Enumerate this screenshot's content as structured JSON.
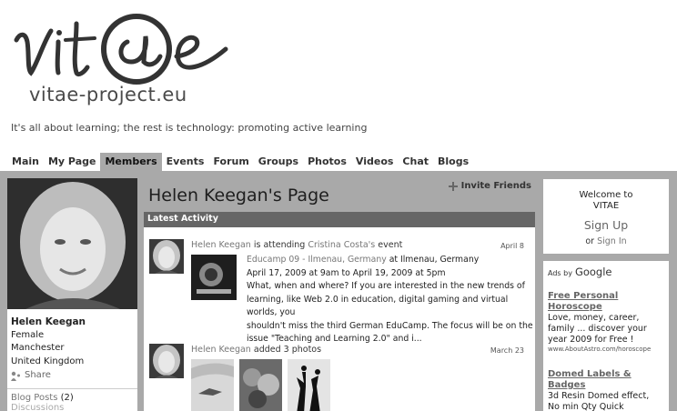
{
  "header": {
    "logo_text": "vitae-project.eu",
    "tagline": "It's all about learning; the rest is technology: promoting active learning"
  },
  "nav": {
    "items": [
      "Main",
      "My Page",
      "Members",
      "Events",
      "Forum",
      "Groups",
      "Photos",
      "Videos",
      "Chat",
      "Blogs"
    ],
    "active": "Members"
  },
  "profile": {
    "name": "Helen Keegan",
    "gender": "Female",
    "city": "Manchester",
    "country": "United Kingdom",
    "share_label": "Share",
    "blog_posts_label": "Blog Posts",
    "blog_posts_count": "(2)",
    "discussions_label": "Discussions"
  },
  "main": {
    "page_title": "Helen Keegan's Page",
    "invite_label": "Invite Friends",
    "activity_header": "Latest Activity",
    "activity": [
      {
        "user": "Helen Keegan",
        "verb": "is attending",
        "target_owner": "Cristina Costa's",
        "target_type": "event",
        "date": "April 8",
        "event_title": "Educamp 09 - Ilmenau, Germany",
        "event_location": "at Ilmenau, Germany",
        "event_time": "April 17, 2009 at 9am to April 19, 2009 at 5pm",
        "event_desc_1": "What, when and where? If you are interested in the new trends of",
        "event_desc_2": "learning, like Web 2.0 in education, digital gaming and virtual worlds, you",
        "event_desc_3": "shouldn't miss the third German EduCamp. The focus will be on the",
        "event_desc_4": "issue \"Teaching and Learning 2.0\" and i..."
      },
      {
        "user": "Helen Keegan",
        "verb": "added 3 photos",
        "date": "March 23"
      }
    ]
  },
  "sidebar": {
    "welcome_1": "Welcome to",
    "welcome_2": "VITAE",
    "signup_label": "Sign Up",
    "or_label": "or",
    "signin_label": "Sign In",
    "ads_by": "Ads by",
    "ads_brand": "Google",
    "ads": [
      {
        "title_1": "Free Personal",
        "title_2": "Horoscope",
        "body_1": "Love, money, career,",
        "body_2": "family ... discover your",
        "body_3": "year 2009 for Free !",
        "url": "www.AboutAstro.com/horoscope"
      },
      {
        "title_1": "Domed Labels &",
        "title_2": "Badges",
        "body_1": "3d Resin Domed effect,",
        "body_2": "No min Qty Quick"
      }
    ]
  },
  "colors": {
    "frame": "#a9a9a9",
    "activity_bar": "#666666",
    "link": "#777777"
  }
}
